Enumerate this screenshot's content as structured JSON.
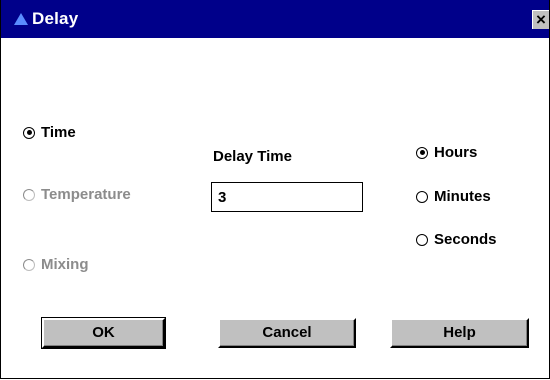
{
  "window": {
    "title": "Delay",
    "close_label": "×"
  },
  "mode_options": [
    {
      "label": "Time",
      "checked": true,
      "enabled": true
    },
    {
      "label": "Temperature",
      "checked": false,
      "enabled": false
    },
    {
      "label": "Mixing",
      "checked": false,
      "enabled": false
    }
  ],
  "delay": {
    "label": "Delay Time",
    "value": "3"
  },
  "unit_options": [
    {
      "label": "Hours",
      "checked": true
    },
    {
      "label": "Minutes",
      "checked": false
    },
    {
      "label": "Seconds",
      "checked": false
    }
  ],
  "buttons": {
    "ok": "OK",
    "cancel": "Cancel",
    "help": "Help"
  },
  "colors": {
    "titlebar": "#00008a",
    "face": "#c0c0c0",
    "disabled_text": "#8c8c8c"
  }
}
